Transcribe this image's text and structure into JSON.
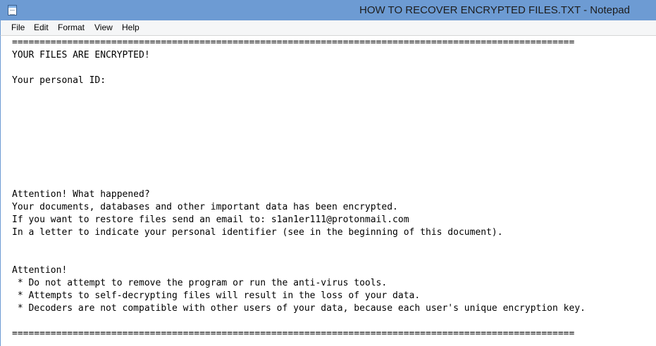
{
  "window": {
    "title": "HOW TO RECOVER ENCRYPTED FILES.TXT - Notepad",
    "icon": "notepad-icon"
  },
  "menu": [
    {
      "label": "File"
    },
    {
      "label": "Edit"
    },
    {
      "label": "Format"
    },
    {
      "label": "View"
    },
    {
      "label": "Help"
    }
  ],
  "document": {
    "separator": "======================================================================================================",
    "heading": "YOUR FILES ARE ENCRYPTED!",
    "personal_id_label": "Your personal ID:",
    "attention_what": "Attention! What happened?",
    "encrypted_msg": "Your documents, databases and other important data has been encrypted.",
    "restore_msg": "If you want to restore files send an email to: s1an1er111@protonmail.com",
    "identifier_msg": "In a letter to indicate your personal identifier (see in the beginning of this document).",
    "attention": "Attention!",
    "warnings": [
      " * Do not attempt to remove the program or run the anti-virus tools.",
      " * Attempts to self-decrypting files will result in the loss of your data.",
      " * Decoders are not compatible with other users of your data, because each user's unique encryption key."
    ]
  }
}
